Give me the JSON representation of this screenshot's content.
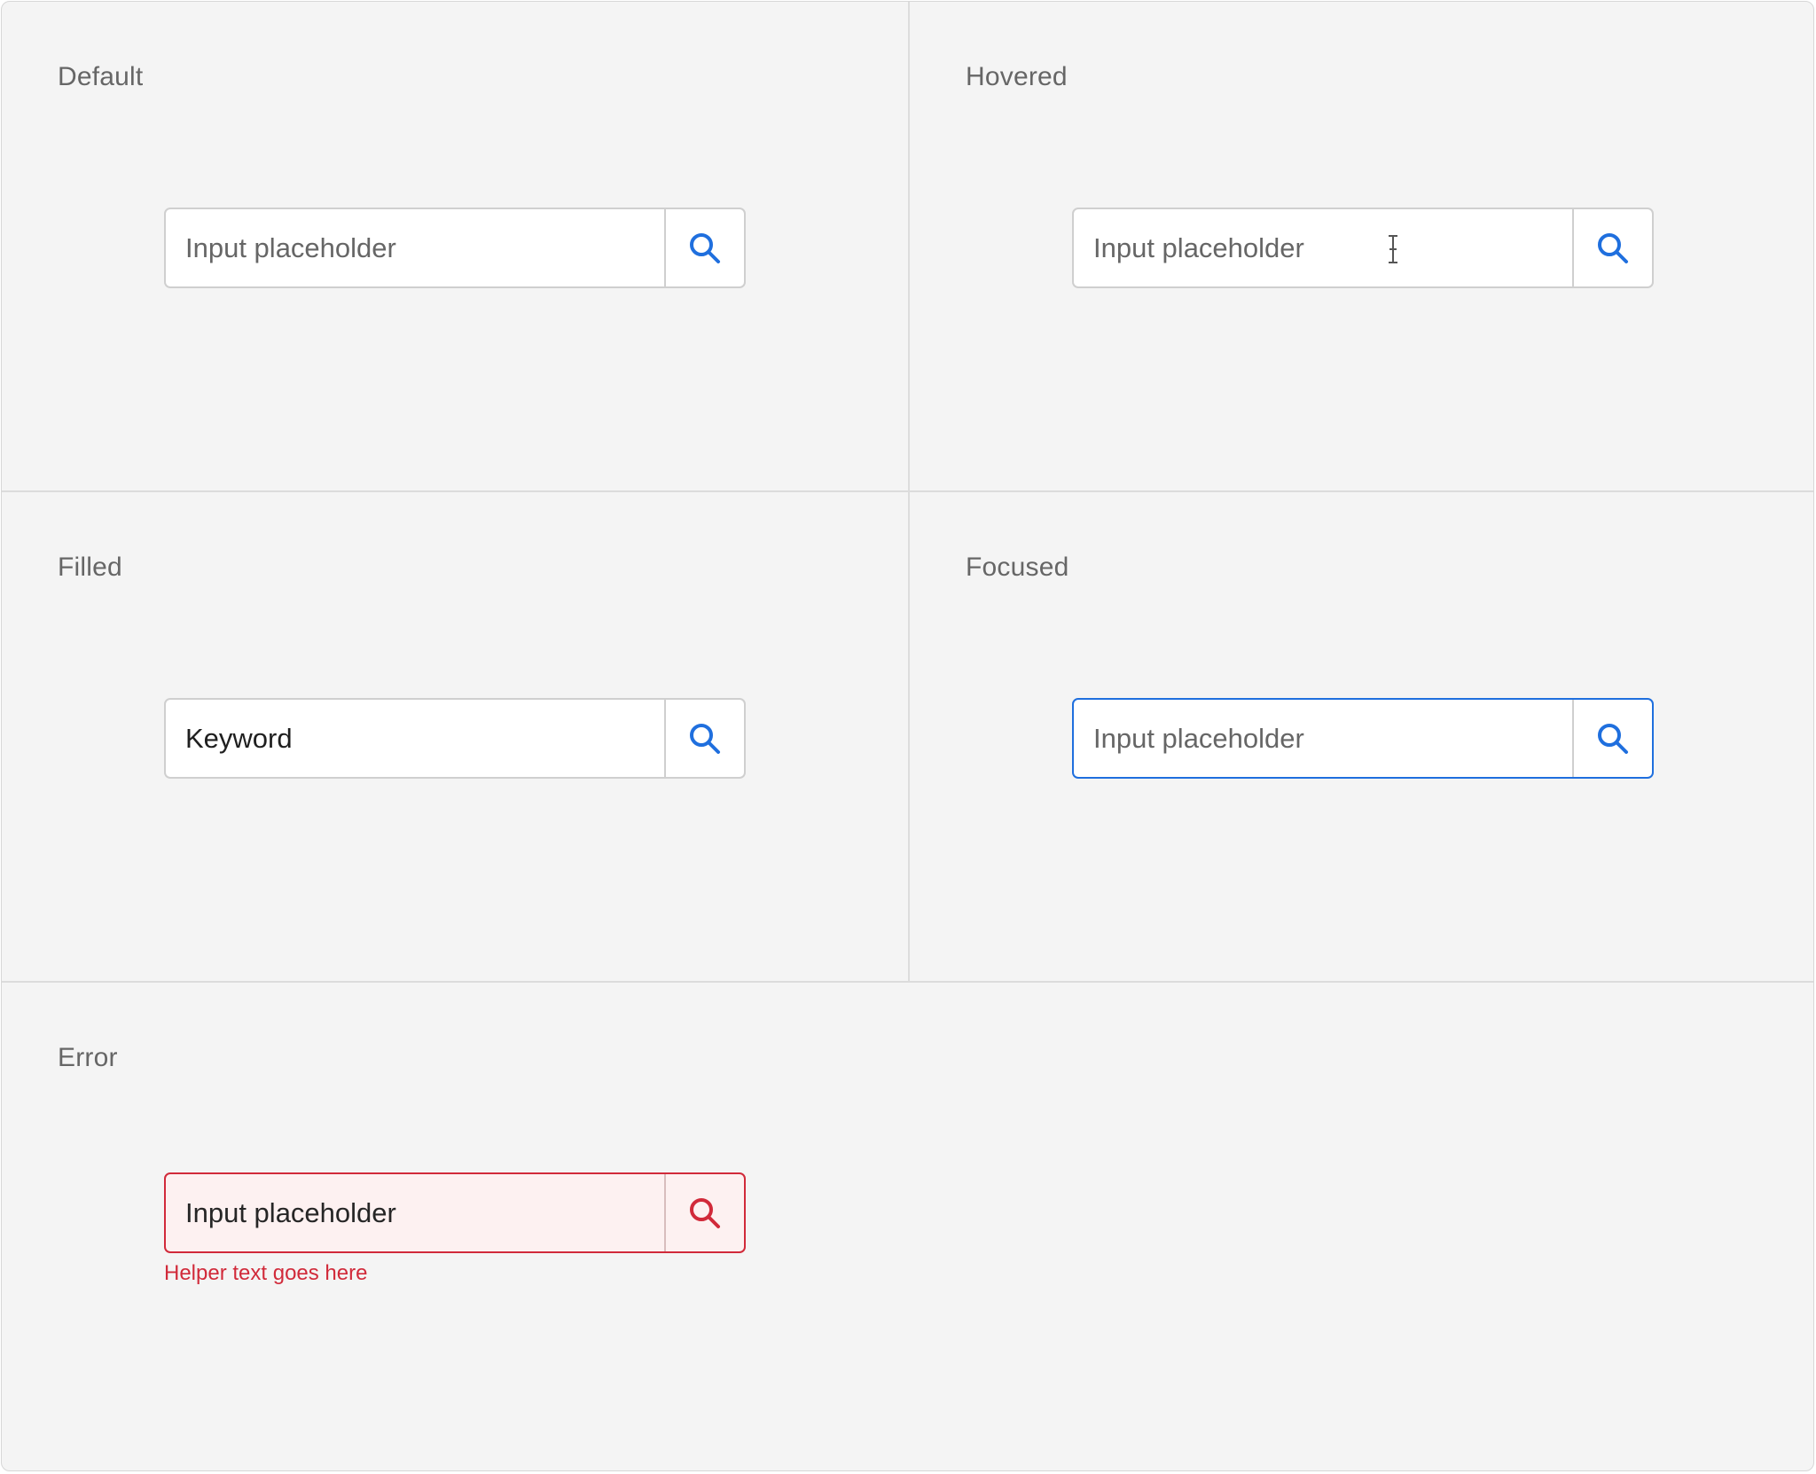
{
  "states": {
    "default": {
      "label": "Default",
      "placeholder": "Input placeholder"
    },
    "hovered": {
      "label": "Hovered",
      "placeholder": "Input placeholder"
    },
    "filled": {
      "label": "Filled",
      "value": "Keyword"
    },
    "focused": {
      "label": "Focused",
      "placeholder": "Input placeholder"
    },
    "error": {
      "label": "Error",
      "value": "Input placeholder",
      "helper_text": "Helper text goes here"
    }
  },
  "icons": {
    "search": "search-icon",
    "cursor": "text-cursor-icon"
  },
  "colors": {
    "background": "#f4f4f4",
    "accent": "#1f6fde",
    "error": "#d12a3a",
    "error_fill": "#fdf1f1",
    "label": "#666666",
    "border": "#cfcfcf"
  }
}
